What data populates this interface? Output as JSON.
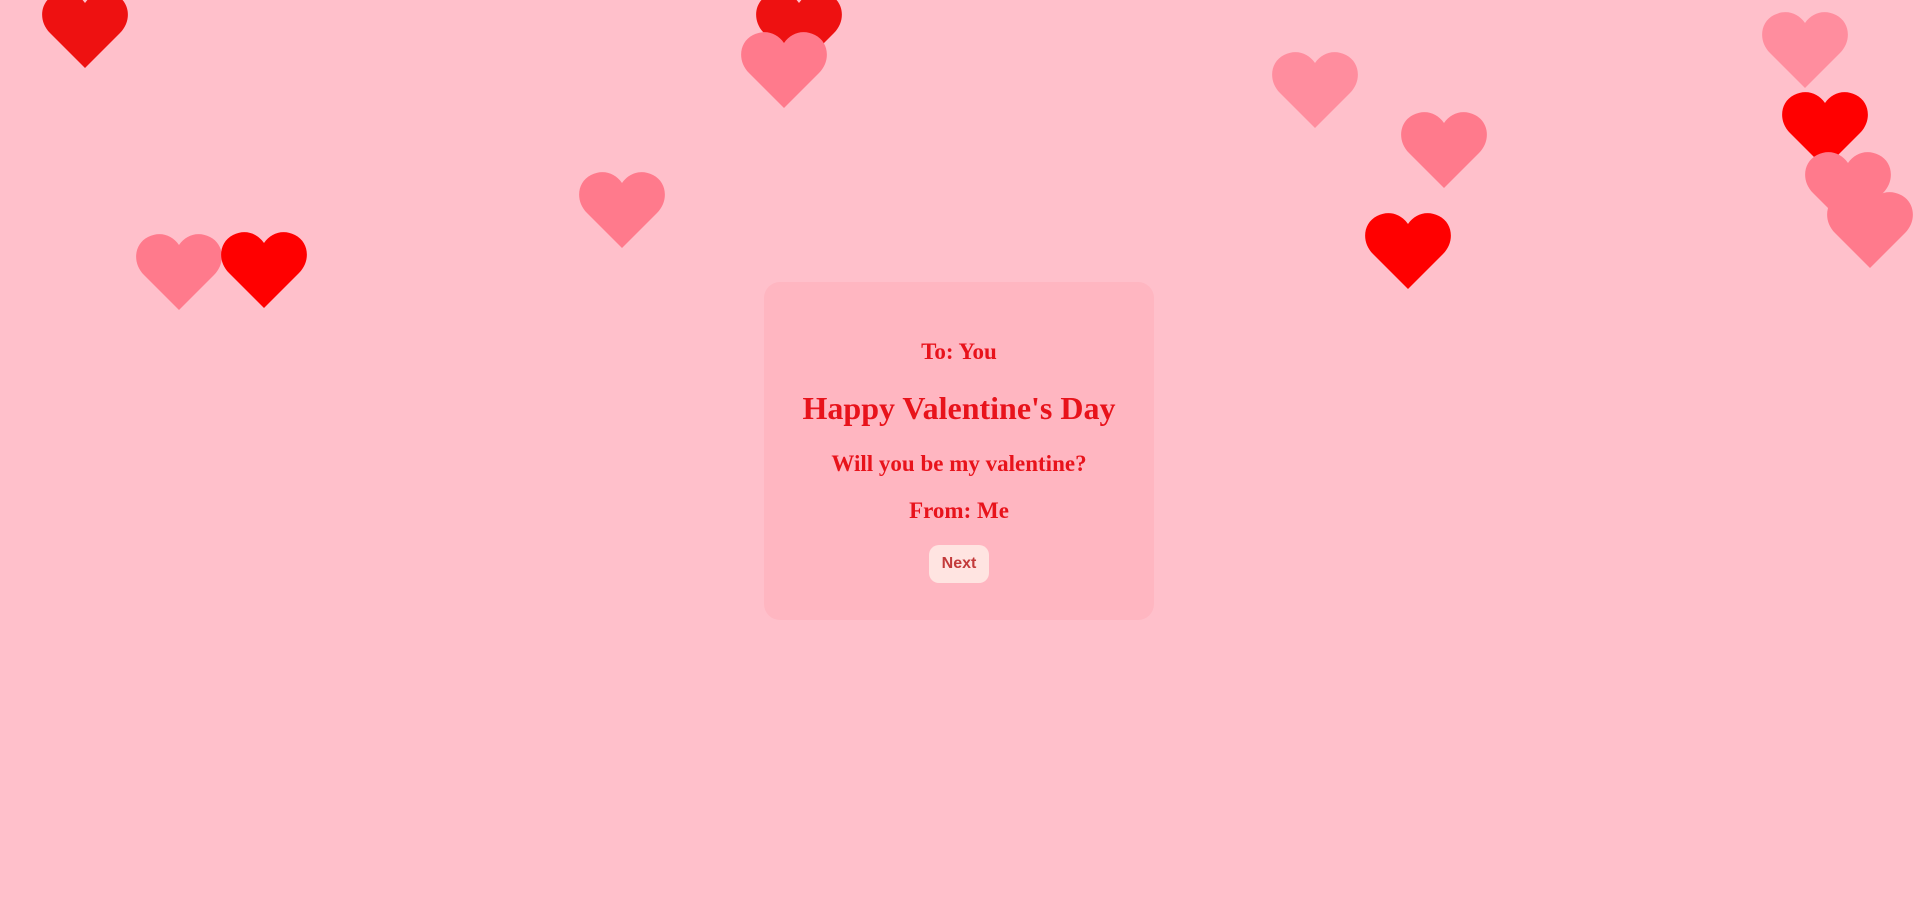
{
  "card": {
    "to_line": "To: You",
    "title": "Happy Valentine's Day",
    "question": "Will you be my valentine?",
    "from_line": "From: Me",
    "next_label": "Next"
  },
  "colors": {
    "background": "#ffc0cb",
    "card_background": "#ffb6c1",
    "text": "#e8131b",
    "button_background": "#ffe4e1",
    "button_text": "#c33a3a",
    "heart_red": "#ff0000",
    "heart_dark_red": "#ee1111",
    "heart_rose": "#ff7a8c",
    "heart_light_rose": "#ff8d9e"
  },
  "hearts": {
    "icon": "heart-icon",
    "count": 14
  }
}
